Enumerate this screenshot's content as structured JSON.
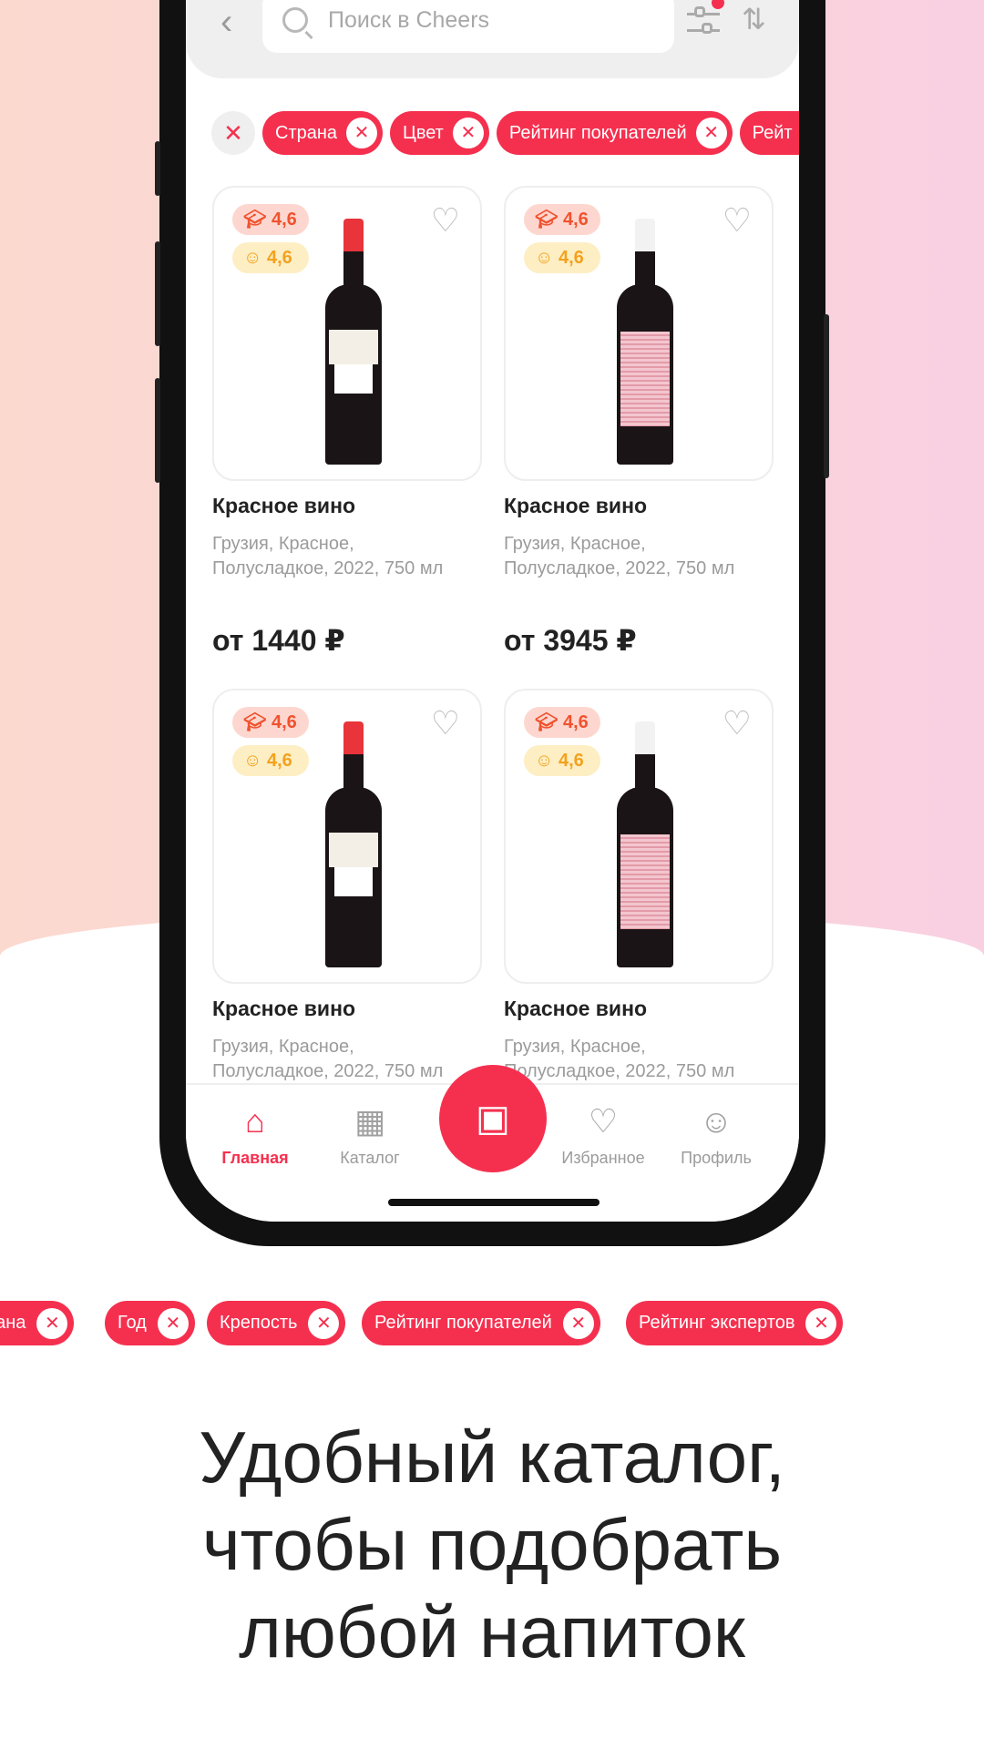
{
  "search": {
    "placeholder": "Поиск в Cheers"
  },
  "filter_chips": [
    "Страна",
    "Цвет",
    "Рейтинг покупателей",
    "Рейт"
  ],
  "products": [
    {
      "title": "Красное вино",
      "desc1": "Грузия, Красное,",
      "desc2": "Полусладкое, 2022, 750 мл",
      "price": "от 1440 ₽",
      "expert_rating": "4,6",
      "buyer_rating": "4,6",
      "cap_color": "#e8343a"
    },
    {
      "title": "Красное вино",
      "desc1": "Грузия, Красное,",
      "desc2": "Полусладкое, 2022, 750 мл",
      "price": "от 3945 ₽",
      "expert_rating": "4,6",
      "buyer_rating": "4,6",
      "cap_color": "#f2f2f2"
    },
    {
      "title": "Красное вино",
      "desc1": "Грузия, Красное,",
      "desc2": "Полусладкое, 2022, 750 мл",
      "expert_rating": "4,6",
      "buyer_rating": "4,6",
      "cap_color": "#e8343a"
    },
    {
      "title": "Красное вино",
      "desc1": "Грузия, Красное,",
      "desc2": "Полусладкое, 2022, 750 мл",
      "expert_rating": "4,6",
      "buyer_rating": "4,6",
      "cap_color": "#f2f2f2"
    }
  ],
  "nav": {
    "home": "Главная",
    "catalog": "Каталог",
    "favorites": "Избранное",
    "profile": "Профиль"
  },
  "bottom_chips": [
    "рана",
    "Год",
    "Крепость",
    "Рейтинг покупателей",
    "Рейтинг экспертов"
  ],
  "headline": [
    "Удобный каталог,",
    "чтобы подобрать",
    "любой напиток"
  ],
  "colors": {
    "accent": "#f5304f"
  }
}
